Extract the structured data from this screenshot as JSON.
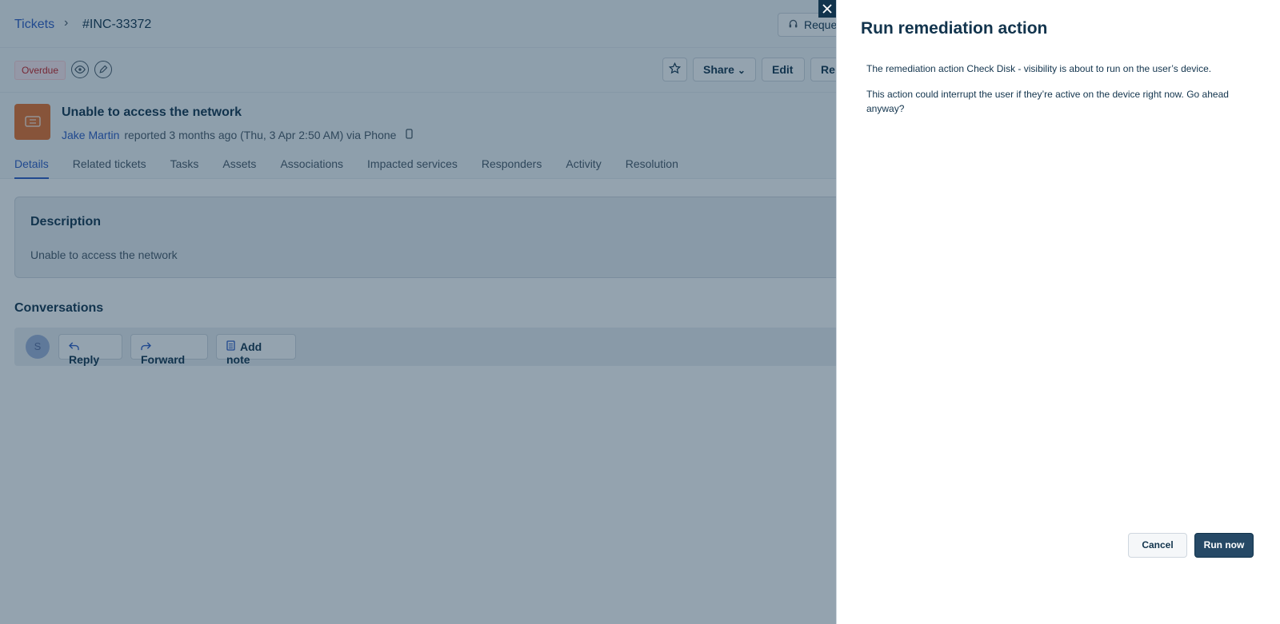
{
  "breadcrumb": {
    "parent": "Tickets",
    "separator": "›",
    "current": "#INC-33372"
  },
  "header": {
    "requester_button": "Reque"
  },
  "toolbar": {
    "status_badge": "Overdue",
    "share_label": "Share",
    "share_caret": "⌄",
    "edit_label": "Edit",
    "more_label": "Re"
  },
  "ticket": {
    "title": "Unable to access the network",
    "requester": "Jake Martin",
    "meta": "reported 3 months ago (Thu, 3 Apr 2:50 AM) via Phone"
  },
  "tabs": [
    {
      "label": "Details"
    },
    {
      "label": "Related tickets"
    },
    {
      "label": "Tasks"
    },
    {
      "label": "Assets"
    },
    {
      "label": "Associations"
    },
    {
      "label": "Impacted services"
    },
    {
      "label": "Responders"
    },
    {
      "label": "Activity"
    },
    {
      "label": "Resolution"
    }
  ],
  "description": {
    "heading": "Description",
    "body": "Unable to access the network"
  },
  "conversations": {
    "heading": "Conversations",
    "avatar_initial": "S",
    "reply_label": "Reply",
    "forward_label": "Forward",
    "add_note_label": "Add note"
  },
  "panel": {
    "title": "Run remediation action",
    "paragraph_1": "The remediation action Check Disk - visibility is about to run on the user’s device.",
    "paragraph_2": "This action could interrupt the user if they’re active on the device right now. Go ahead anyway?",
    "cancel_label": "Cancel",
    "run_label": "Run now"
  },
  "colors": {
    "accent": "#2c5cc5",
    "primary_button": "#264966",
    "overdue": "#c82124",
    "ticket_icon": "#e86f2b"
  }
}
